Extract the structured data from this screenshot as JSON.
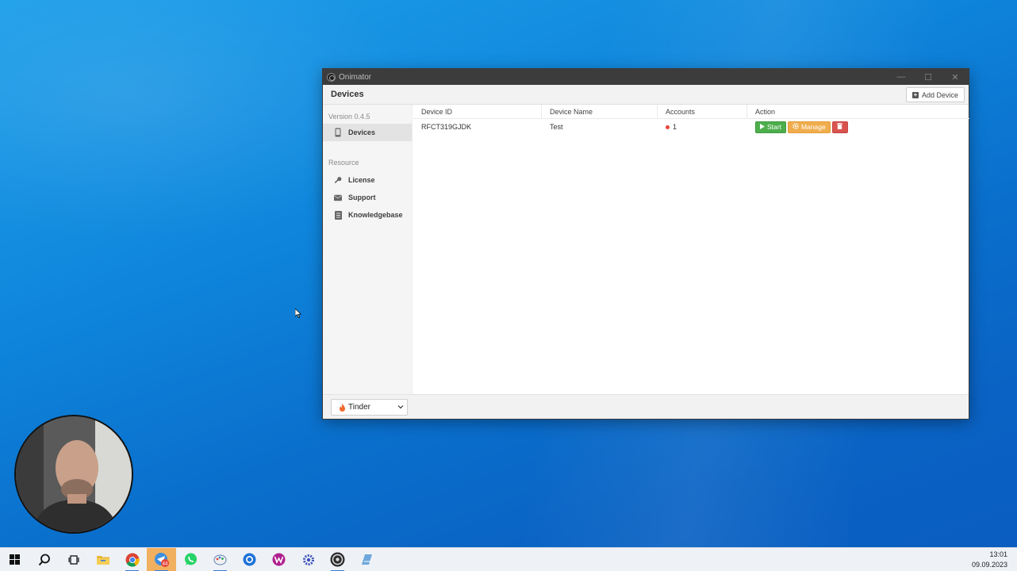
{
  "window": {
    "title": "Onimator",
    "controls": {
      "minimize": "—",
      "maximize": "☐",
      "close": "✕"
    }
  },
  "header": {
    "title": "Devices",
    "add_device_label": "Add Device"
  },
  "sidebar": {
    "version": "Version 0.4.5",
    "items": [
      {
        "label": "Devices",
        "icon": "mobile-phone-icon",
        "active": true
      }
    ],
    "resource_label": "Resource",
    "resource_items": [
      {
        "label": "License",
        "icon": "key-icon"
      },
      {
        "label": "Support",
        "icon": "envelope-icon"
      },
      {
        "label": "Knowledgebase",
        "icon": "book-icon"
      }
    ]
  },
  "table": {
    "columns": [
      "Device ID",
      "Device Name",
      "Accounts",
      "Action"
    ],
    "rows": [
      {
        "device_id": "RFCT319GJDK",
        "device_name": "Test",
        "accounts": "1",
        "actions": {
          "start": "Start",
          "manage": "Manage"
        }
      }
    ]
  },
  "footer": {
    "platform_selected": "Tinder"
  },
  "taskbar": {
    "items": [
      "windows-start-icon",
      "search-icon",
      "task-view-icon",
      "file-explorer-icon",
      "chrome-icon",
      "app-badge-icon",
      "whatsapp-icon",
      "paint-icon",
      "browser-icon",
      "app-w-icon",
      "settings-icon",
      "onimator-icon",
      "app-window-icon"
    ],
    "badge_count": "44",
    "time": "13:01",
    "date": "09.09.2023"
  },
  "colors": {
    "start": "#4cae4c",
    "manage": "#f0ad4e",
    "delete": "#d9534f",
    "titlebar": "#3c3c3c"
  }
}
